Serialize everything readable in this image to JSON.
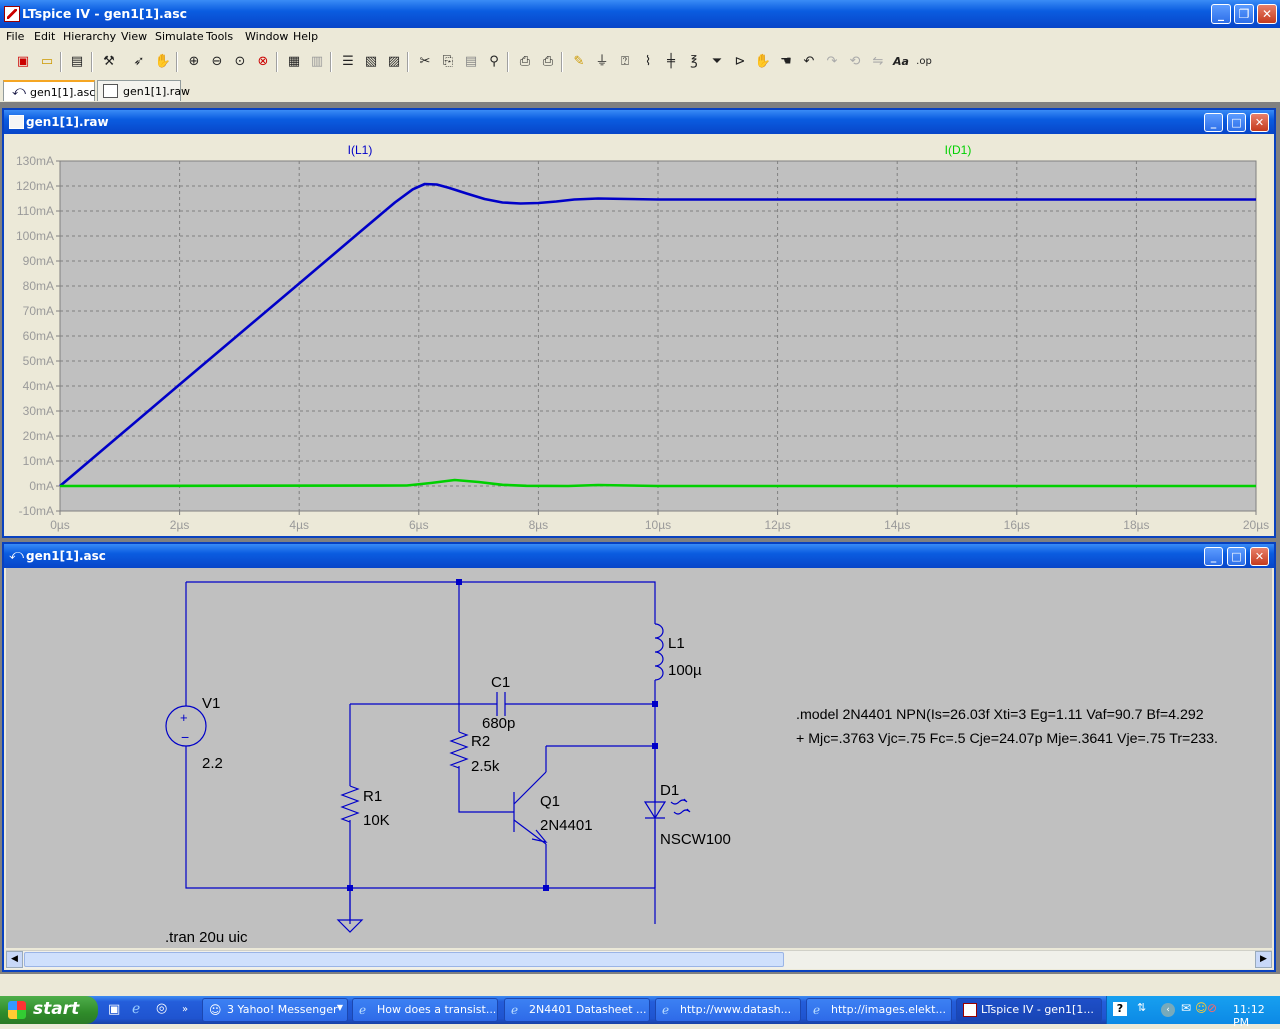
{
  "app": {
    "title": "LTspice IV - gen1[1].asc",
    "controls": {
      "minimize": "_",
      "restore": "❐",
      "close": "✕"
    }
  },
  "menu": [
    "File",
    "Edit",
    "Hierarchy",
    "View",
    "Simulate",
    "Tools",
    "Window",
    "Help"
  ],
  "toolbar": {
    "icons": [
      "new-schematic-icon",
      "open-icon",
      "save-icon",
      "control-panel-icon",
      "run-icon",
      "halt-icon",
      "zoom-in-icon",
      "zoom-out-icon",
      "zoom-full-icon",
      "cancel-zoom-icon",
      "autorange-icon",
      "grid-icon",
      "tile-horizontal-icon",
      "tile-vertical-icon",
      "cascade-icon",
      "cut-icon",
      "copy-icon",
      "paste-icon",
      "find-icon",
      "print-preview-icon",
      "print-icon",
      "wire-icon",
      "ground-icon",
      "label-icon",
      "resistor-icon",
      "capacitor-icon",
      "inductor-icon",
      "diode-icon",
      "component-icon",
      "move-icon",
      "drag-icon",
      "undo-icon",
      "redo-icon",
      "rotate-icon",
      "mirror-icon",
      "text-icon",
      "spice-directive-icon"
    ],
    "text_label": "Aa",
    "directive_label": ".op"
  },
  "tabs": [
    {
      "label": "gen1[1].asc",
      "active": true
    },
    {
      "label": "gen1[1].raw",
      "active": false
    }
  ],
  "waveform_window": {
    "title": "gen1[1].raw",
    "trace_labels": [
      "I(L1)",
      "I(D1)"
    ]
  },
  "chart_data": {
    "type": "line",
    "xlabel": "",
    "ylabel": "",
    "xlim": [
      0,
      20
    ],
    "ylim": [
      -10,
      130
    ],
    "x_ticks": [
      "0µs",
      "2µs",
      "4µs",
      "6µs",
      "8µs",
      "10µs",
      "12µs",
      "14µs",
      "16µs",
      "18µs",
      "20µs"
    ],
    "y_ticks": [
      "130mA",
      "120mA",
      "110mA",
      "100mA",
      "90mA",
      "80mA",
      "70mA",
      "60mA",
      "50mA",
      "40mA",
      "30mA",
      "20mA",
      "10mA",
      "0mA",
      "-10mA"
    ],
    "grid": true,
    "series": [
      {
        "name": "I(L1)",
        "color": "#0000c8",
        "x": [
          0,
          1,
          2,
          3,
          4,
          5,
          5.6,
          5.9,
          6.1,
          6.3,
          6.5,
          6.8,
          7.1,
          7.4,
          7.7,
          8.0,
          8.3,
          8.6,
          9.0,
          9.5,
          10,
          12,
          14,
          16,
          18,
          20
        ],
        "y": [
          0,
          20.3,
          40.6,
          60.8,
          81,
          101.3,
          113.4,
          118.7,
          120.8,
          120.6,
          119.3,
          117,
          114.8,
          113.4,
          113,
          113.2,
          113.8,
          114.6,
          115,
          114.8,
          114.6,
          114.6,
          114.6,
          114.6,
          114.6,
          114.6
        ]
      },
      {
        "name": "I(D1)",
        "color": "#00d000",
        "x": [
          0,
          5.8,
          6.2,
          6.6,
          7.0,
          7.4,
          7.8,
          8.5,
          9.0,
          9.5,
          10,
          12,
          14,
          16,
          18,
          20
        ],
        "y": [
          0,
          0.2,
          1.2,
          2.4,
          1.6,
          0.5,
          0.1,
          0,
          0.4,
          0.2,
          0,
          0,
          0,
          0,
          0,
          0
        ]
      }
    ]
  },
  "schematic_window": {
    "title": "gen1[1].asc",
    "components": {
      "V1": {
        "name": "V1",
        "value": "2.2"
      },
      "C1": {
        "name": "C1",
        "value": "680p"
      },
      "L1": {
        "name": "L1",
        "value": "100µ"
      },
      "R2": {
        "name": "R2",
        "value": "2.5k"
      },
      "R1": {
        "name": "R1",
        "value": "10K"
      },
      "Q1": {
        "name": "Q1",
        "value": "2N4401"
      },
      "D1": {
        "name": "D1",
        "value": "NSCW100"
      }
    },
    "directives": {
      "model_line1": ".model 2N4401   NPN(Is=26.03f Xti=3 Eg=1.11 Vaf=90.7 Bf=4.292",
      "model_line2": "+ Mjc=.3763 Vjc=.75 Fc=.5 Cje=24.07p Mje=.3641 Vje=.75 Tr=233.",
      "tran": ".tran 20u uic"
    }
  },
  "taskbar": {
    "start_label": "start",
    "tasks": [
      {
        "label": "3 Yahoo! Messenger",
        "icon": "yahoo-messenger-icon"
      },
      {
        "label": "How does a transist...",
        "icon": "internet-explorer-icon"
      },
      {
        "label": "2N4401 Datasheet ...",
        "icon": "internet-explorer-icon"
      },
      {
        "label": "http://www.datash...",
        "icon": "internet-explorer-icon"
      },
      {
        "label": "http://images.elekt...",
        "icon": "internet-explorer-icon"
      },
      {
        "label": "LTspice IV - gen1[1...",
        "icon": "ltspice-icon",
        "active": true
      }
    ],
    "clock": "11:12 PM"
  },
  "colors": {
    "plot_bg": "#c0c0c0",
    "grid": "#808080",
    "trace_l1": "#0000c8",
    "trace_d1": "#00d000",
    "wire": "#0000c8"
  }
}
